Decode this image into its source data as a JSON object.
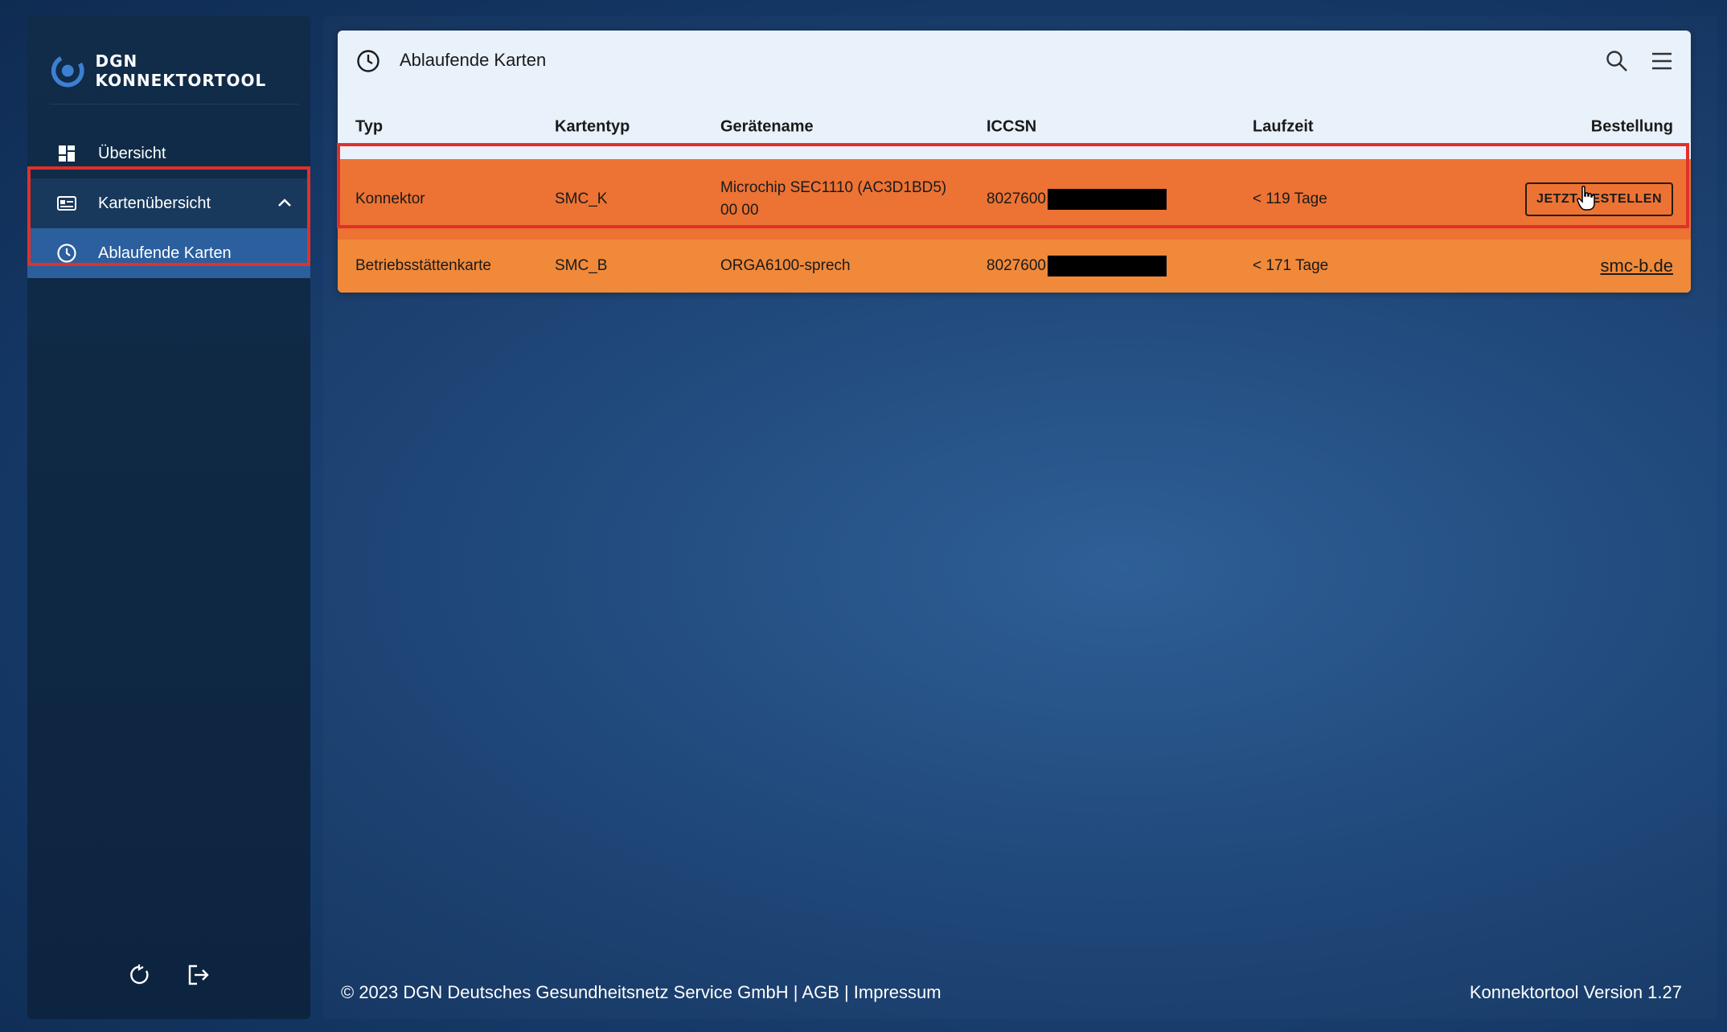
{
  "brand": {
    "name": "DGN KONNEKTORTOOL"
  },
  "sidebar": {
    "items": [
      {
        "label": "Übersicht",
        "icon": "dashboard-icon"
      },
      {
        "label": "Kartenübersicht",
        "icon": "card-overview-icon",
        "expanded": true
      },
      {
        "label": "Ablaufende Karten",
        "icon": "clock-icon",
        "active": true
      }
    ],
    "bottom": [
      {
        "icon": "refresh-icon"
      },
      {
        "icon": "logout-icon"
      }
    ]
  },
  "card": {
    "title": "Ablaufende Karten",
    "columns": [
      "Typ",
      "Kartentyp",
      "Gerätename",
      "ICCSN",
      "Laufzeit",
      "Bestellung"
    ],
    "rows": [
      {
        "typ": "Konnektor",
        "kartentyp": "SMC_K",
        "geraetename_line1": "Microchip SEC1110 (AC3D1BD5)",
        "geraetename_line2": "00 00",
        "iccsn": "8027600",
        "laufzeit": "< 119 Tage",
        "bestellung": "JETZT BESTELLEN",
        "highlighted": true
      },
      {
        "typ": "Betriebsstättenkarte",
        "kartentyp": "SMC_B",
        "geraetename_line1": "ORGA6100-sprech",
        "iccsn": "8027600",
        "laufzeit": "< 171 Tage",
        "bestellung": "smc-b.de"
      }
    ]
  },
  "footer": {
    "copyright": "© 2023 DGN Deutsches Gesundheitsnetz Service GmbH | AGB | Impressum",
    "version": "Konnektortool Version 1.27"
  },
  "colors": {
    "row_highlight": "#ec7334",
    "row_normal": "#f0893a",
    "annotation_red": "#e0312a",
    "sidebar_active": "#2b5f9e"
  }
}
